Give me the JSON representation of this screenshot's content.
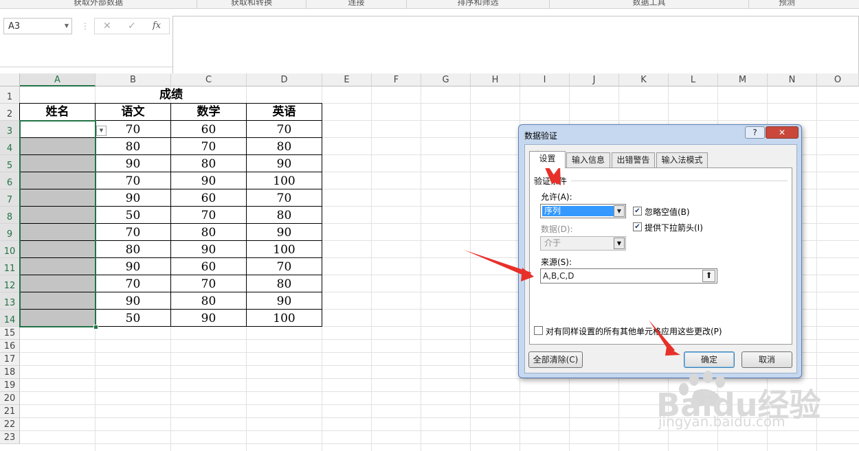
{
  "ribbon": {
    "groups": [
      "获取外部数据",
      "获取和转换",
      "连接",
      "排序和筛选",
      "数据工具",
      "预测"
    ]
  },
  "formula_bar": {
    "name_box": "A3",
    "cancel_glyph": "✕",
    "enter_glyph": "✓",
    "fx_glyph": "fx",
    "formula": ""
  },
  "columns": [
    "A",
    "B",
    "C",
    "D",
    "E",
    "F",
    "G",
    "H",
    "I",
    "J",
    "K",
    "L",
    "M",
    "N",
    "O"
  ],
  "rows": [
    "1",
    "2",
    "3",
    "4",
    "5",
    "6",
    "7",
    "8",
    "9",
    "10",
    "11",
    "12",
    "13",
    "14",
    "15",
    "16",
    "17",
    "18",
    "19",
    "20",
    "21",
    "22",
    "23"
  ],
  "sheet": {
    "title": "成绩",
    "headers": [
      "姓名",
      "语文",
      "数学",
      "英语"
    ],
    "data": [
      [
        "",
        "70",
        "60",
        "70"
      ],
      [
        "",
        "80",
        "70",
        "80"
      ],
      [
        "",
        "90",
        "80",
        "90"
      ],
      [
        "",
        "70",
        "90",
        "100"
      ],
      [
        "",
        "90",
        "60",
        "70"
      ],
      [
        "",
        "50",
        "70",
        "80"
      ],
      [
        "",
        "70",
        "80",
        "90"
      ],
      [
        "",
        "80",
        "90",
        "100"
      ],
      [
        "",
        "90",
        "60",
        "70"
      ],
      [
        "",
        "70",
        "70",
        "80"
      ],
      [
        "",
        "90",
        "80",
        "90"
      ],
      [
        "",
        "50",
        "90",
        "100"
      ]
    ]
  },
  "dialog": {
    "title": "数据验证",
    "help": "?",
    "close": "✕",
    "tabs": [
      "设置",
      "输入信息",
      "出错警告",
      "输入法模式"
    ],
    "group_label": "验证条件",
    "allow_label": "允许(A):",
    "allow_value": "序列",
    "ignore_blank": {
      "label": "忽略空值(B)",
      "checked": true
    },
    "dropdown_arrow": {
      "label": "提供下拉箭头(I)",
      "checked": true
    },
    "data_label": "数据(D):",
    "data_value": "介于",
    "source_label": "来源(S):",
    "source_value": "A,B,C,D",
    "apply_all": {
      "label": "对有同样设置的所有其他单元格应用这些更改(P)",
      "checked": false
    },
    "clear_all": "全部清除(C)",
    "ok": "确定",
    "cancel": "取消"
  },
  "watermark": {
    "brand": "Baidu经验",
    "url": "jingyan.baidu.com"
  },
  "colors": {
    "excel_green": "#217346",
    "annotation_red": "#e8302a",
    "dialog_frame": "#c6d8ef",
    "selection_fill": "#c4c4c4"
  }
}
